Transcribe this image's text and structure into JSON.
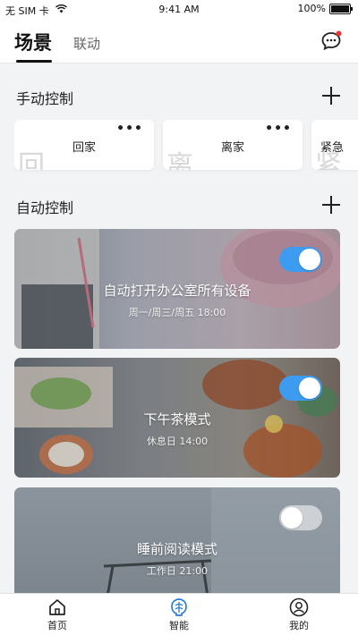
{
  "status_bar": {
    "carrier": "无 SIM 卡",
    "time": "9:41 AM",
    "battery": "100%"
  },
  "header": {
    "tabs": [
      {
        "label": "场景",
        "active": true
      },
      {
        "label": "联动",
        "active": false
      }
    ],
    "message_icon": "message-bubble-icon"
  },
  "manual": {
    "title": "手动控制",
    "add_icon": "plus-icon",
    "items": [
      {
        "label": "回家",
        "more": "•••",
        "watermark": "回"
      },
      {
        "label": "离家",
        "more": "•••",
        "watermark": "离"
      },
      {
        "label": "紧急",
        "more": "",
        "watermark": "紧"
      }
    ]
  },
  "automation": {
    "title": "自动控制",
    "add_icon": "plus-icon",
    "items": [
      {
        "title": "自动打开办公室所有设备",
        "schedule": "周一/周三/周五 18:00",
        "enabled": true
      },
      {
        "title": "下午茶模式",
        "schedule": "休息日 14:00",
        "enabled": true
      },
      {
        "title": "睡前阅读模式",
        "schedule": "工作日 21:00",
        "enabled": false
      }
    ]
  },
  "bottom_nav": {
    "items": [
      {
        "label": "首页",
        "icon": "home-icon"
      },
      {
        "label": "智能",
        "icon": "brain-icon"
      },
      {
        "label": "我的",
        "icon": "user-icon"
      }
    ]
  },
  "colors": {
    "accent": "#3d9cf0",
    "background": "#f2f3f5"
  }
}
